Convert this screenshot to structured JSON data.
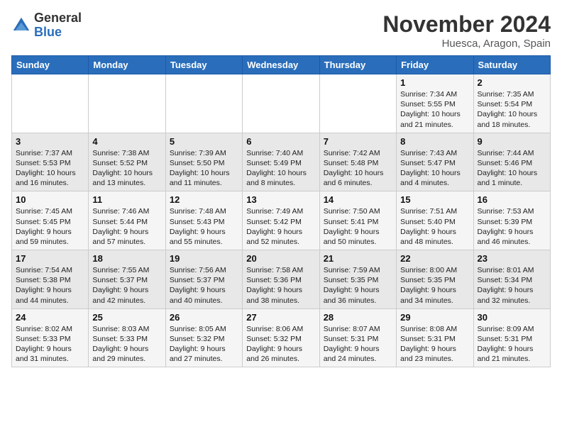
{
  "header": {
    "logo_general": "General",
    "logo_blue": "Blue",
    "month_title": "November 2024",
    "location": "Huesca, Aragon, Spain"
  },
  "days_of_week": [
    "Sunday",
    "Monday",
    "Tuesday",
    "Wednesday",
    "Thursday",
    "Friday",
    "Saturday"
  ],
  "weeks": [
    [
      {
        "day": "",
        "info": ""
      },
      {
        "day": "",
        "info": ""
      },
      {
        "day": "",
        "info": ""
      },
      {
        "day": "",
        "info": ""
      },
      {
        "day": "",
        "info": ""
      },
      {
        "day": "1",
        "info": "Sunrise: 7:34 AM\nSunset: 5:55 PM\nDaylight: 10 hours\nand 21 minutes."
      },
      {
        "day": "2",
        "info": "Sunrise: 7:35 AM\nSunset: 5:54 PM\nDaylight: 10 hours\nand 18 minutes."
      }
    ],
    [
      {
        "day": "3",
        "info": "Sunrise: 7:37 AM\nSunset: 5:53 PM\nDaylight: 10 hours\nand 16 minutes."
      },
      {
        "day": "4",
        "info": "Sunrise: 7:38 AM\nSunset: 5:52 PM\nDaylight: 10 hours\nand 13 minutes."
      },
      {
        "day": "5",
        "info": "Sunrise: 7:39 AM\nSunset: 5:50 PM\nDaylight: 10 hours\nand 11 minutes."
      },
      {
        "day": "6",
        "info": "Sunrise: 7:40 AM\nSunset: 5:49 PM\nDaylight: 10 hours\nand 8 minutes."
      },
      {
        "day": "7",
        "info": "Sunrise: 7:42 AM\nSunset: 5:48 PM\nDaylight: 10 hours\nand 6 minutes."
      },
      {
        "day": "8",
        "info": "Sunrise: 7:43 AM\nSunset: 5:47 PM\nDaylight: 10 hours\nand 4 minutes."
      },
      {
        "day": "9",
        "info": "Sunrise: 7:44 AM\nSunset: 5:46 PM\nDaylight: 10 hours\nand 1 minute."
      }
    ],
    [
      {
        "day": "10",
        "info": "Sunrise: 7:45 AM\nSunset: 5:45 PM\nDaylight: 9 hours\nand 59 minutes."
      },
      {
        "day": "11",
        "info": "Sunrise: 7:46 AM\nSunset: 5:44 PM\nDaylight: 9 hours\nand 57 minutes."
      },
      {
        "day": "12",
        "info": "Sunrise: 7:48 AM\nSunset: 5:43 PM\nDaylight: 9 hours\nand 55 minutes."
      },
      {
        "day": "13",
        "info": "Sunrise: 7:49 AM\nSunset: 5:42 PM\nDaylight: 9 hours\nand 52 minutes."
      },
      {
        "day": "14",
        "info": "Sunrise: 7:50 AM\nSunset: 5:41 PM\nDaylight: 9 hours\nand 50 minutes."
      },
      {
        "day": "15",
        "info": "Sunrise: 7:51 AM\nSunset: 5:40 PM\nDaylight: 9 hours\nand 48 minutes."
      },
      {
        "day": "16",
        "info": "Sunrise: 7:53 AM\nSunset: 5:39 PM\nDaylight: 9 hours\nand 46 minutes."
      }
    ],
    [
      {
        "day": "17",
        "info": "Sunrise: 7:54 AM\nSunset: 5:38 PM\nDaylight: 9 hours\nand 44 minutes."
      },
      {
        "day": "18",
        "info": "Sunrise: 7:55 AM\nSunset: 5:37 PM\nDaylight: 9 hours\nand 42 minutes."
      },
      {
        "day": "19",
        "info": "Sunrise: 7:56 AM\nSunset: 5:37 PM\nDaylight: 9 hours\nand 40 minutes."
      },
      {
        "day": "20",
        "info": "Sunrise: 7:58 AM\nSunset: 5:36 PM\nDaylight: 9 hours\nand 38 minutes."
      },
      {
        "day": "21",
        "info": "Sunrise: 7:59 AM\nSunset: 5:35 PM\nDaylight: 9 hours\nand 36 minutes."
      },
      {
        "day": "22",
        "info": "Sunrise: 8:00 AM\nSunset: 5:35 PM\nDaylight: 9 hours\nand 34 minutes."
      },
      {
        "day": "23",
        "info": "Sunrise: 8:01 AM\nSunset: 5:34 PM\nDaylight: 9 hours\nand 32 minutes."
      }
    ],
    [
      {
        "day": "24",
        "info": "Sunrise: 8:02 AM\nSunset: 5:33 PM\nDaylight: 9 hours\nand 31 minutes."
      },
      {
        "day": "25",
        "info": "Sunrise: 8:03 AM\nSunset: 5:33 PM\nDaylight: 9 hours\nand 29 minutes."
      },
      {
        "day": "26",
        "info": "Sunrise: 8:05 AM\nSunset: 5:32 PM\nDaylight: 9 hours\nand 27 minutes."
      },
      {
        "day": "27",
        "info": "Sunrise: 8:06 AM\nSunset: 5:32 PM\nDaylight: 9 hours\nand 26 minutes."
      },
      {
        "day": "28",
        "info": "Sunrise: 8:07 AM\nSunset: 5:31 PM\nDaylight: 9 hours\nand 24 minutes."
      },
      {
        "day": "29",
        "info": "Sunrise: 8:08 AM\nSunset: 5:31 PM\nDaylight: 9 hours\nand 23 minutes."
      },
      {
        "day": "30",
        "info": "Sunrise: 8:09 AM\nSunset: 5:31 PM\nDaylight: 9 hours\nand 21 minutes."
      }
    ]
  ]
}
